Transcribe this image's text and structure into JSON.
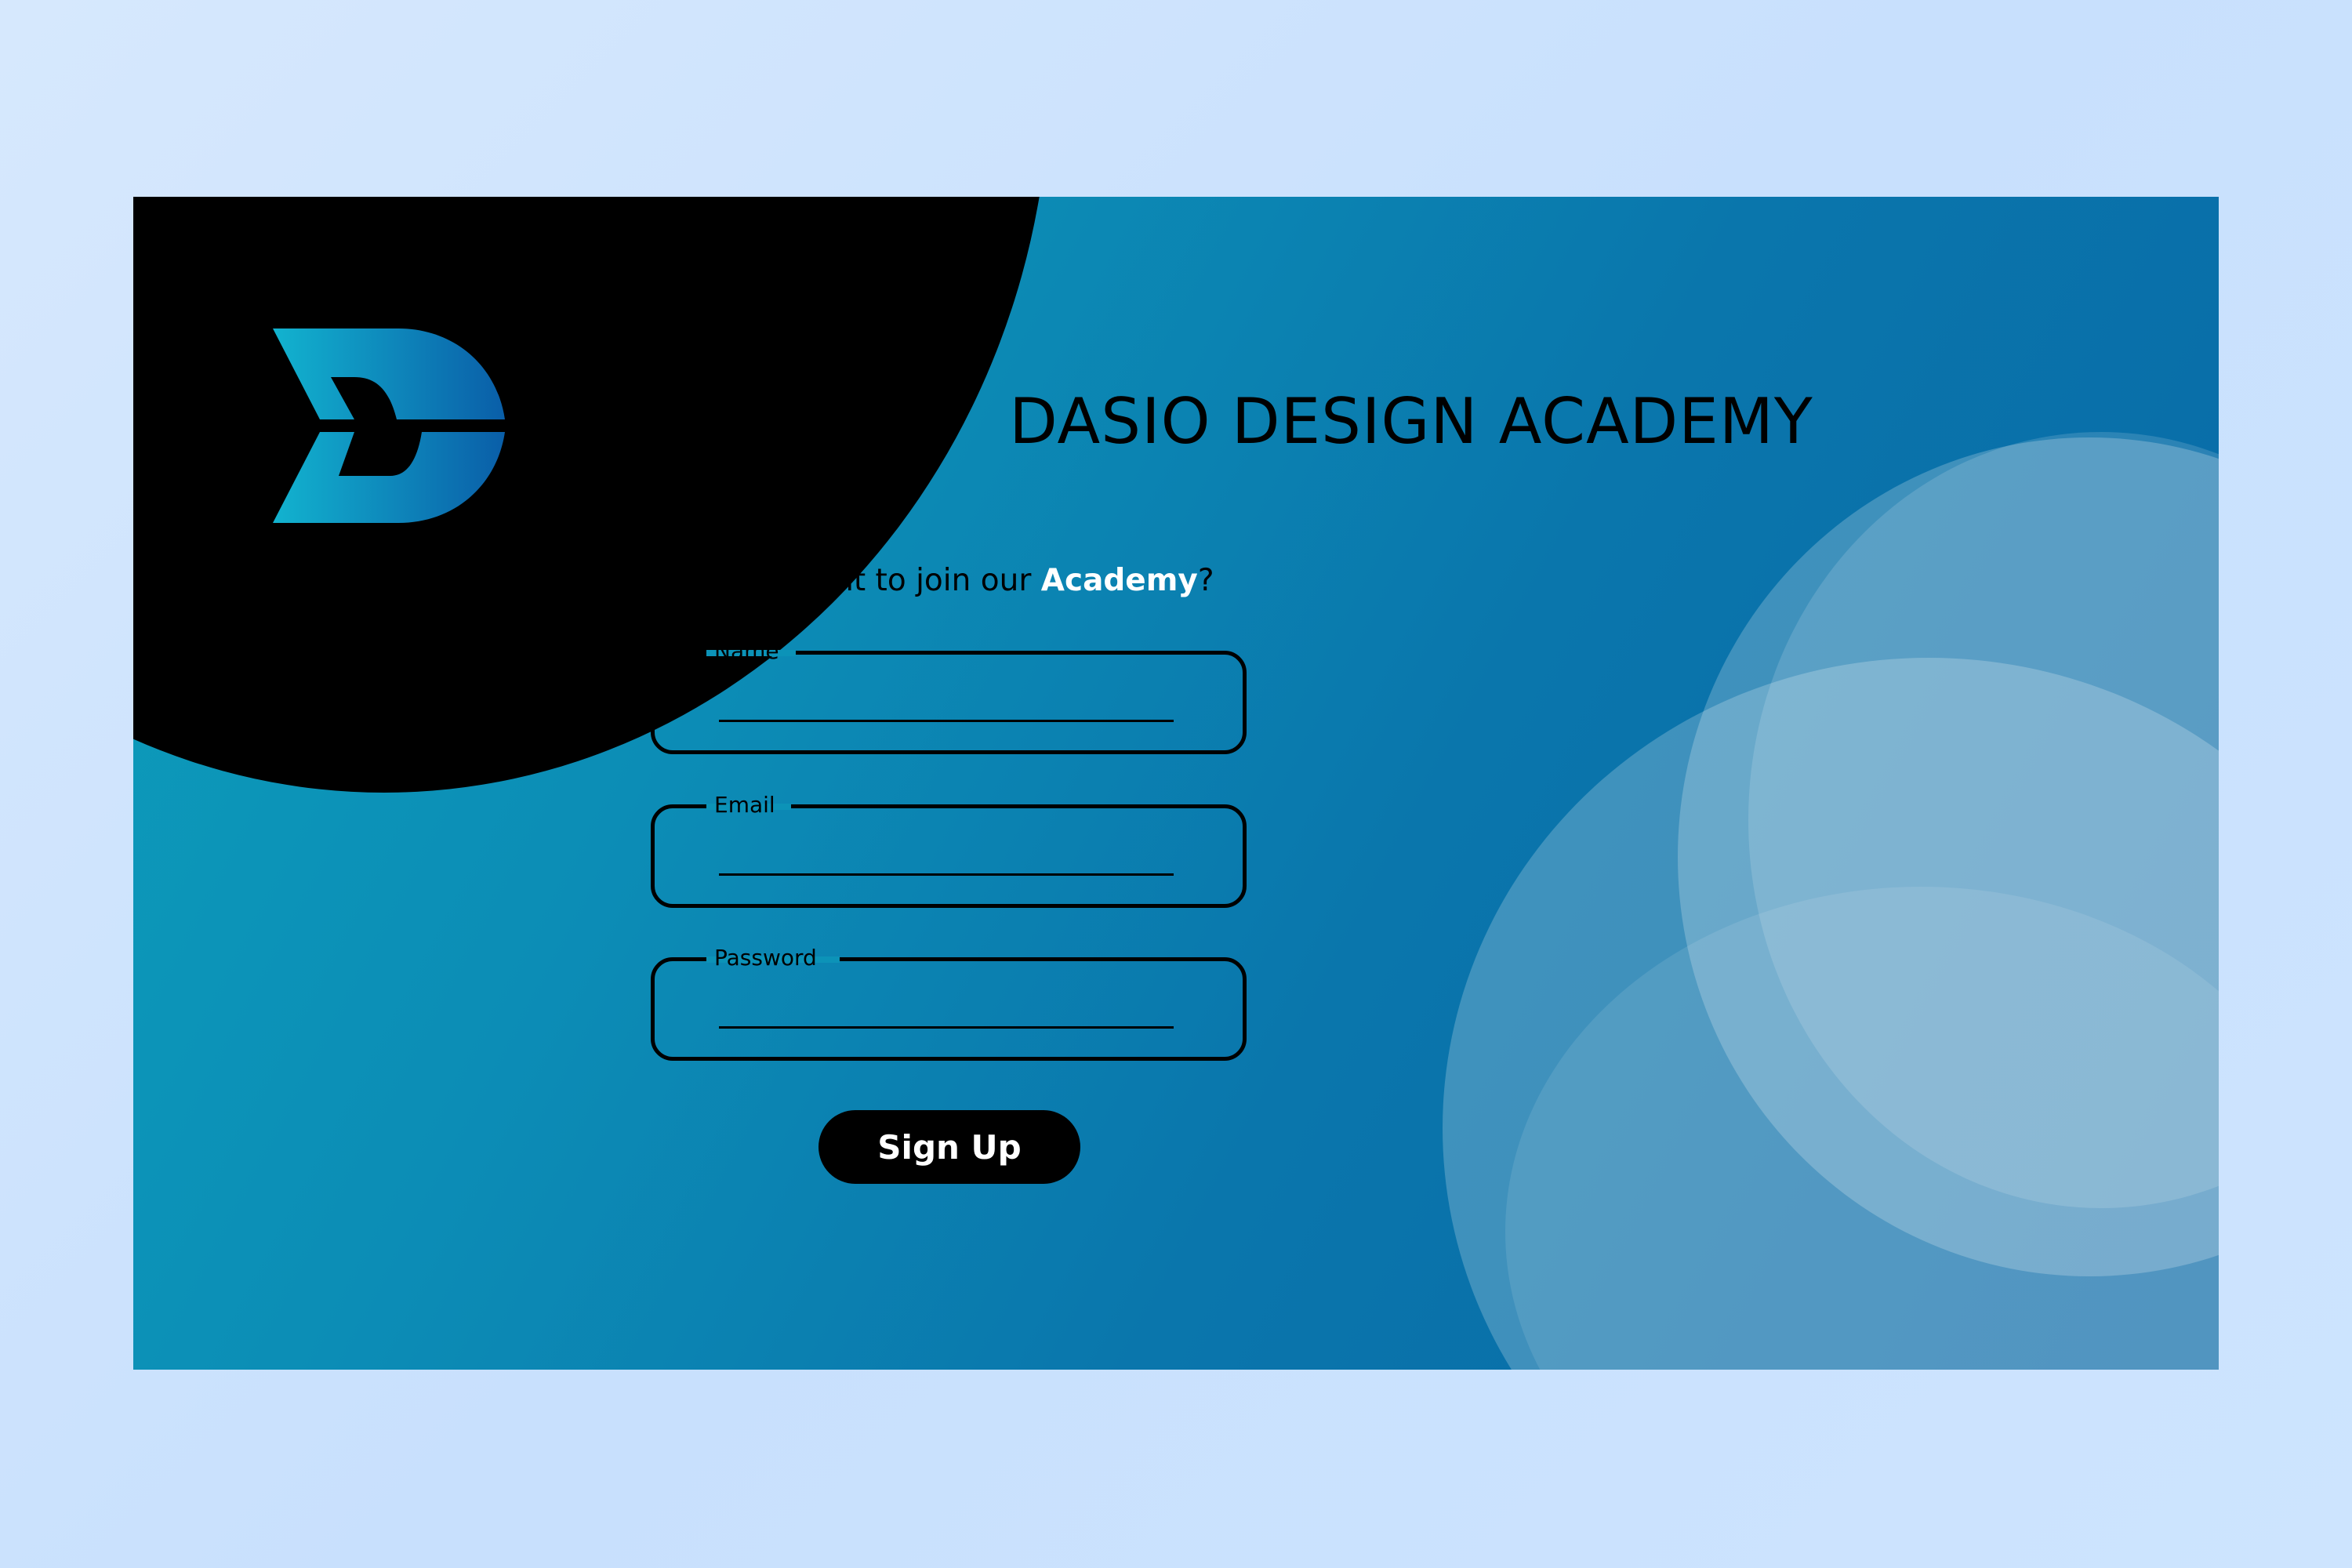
{
  "brand": {
    "logo_icon": "dasio-d-logo",
    "title": "DASIO DESIGN ACADEMY"
  },
  "form": {
    "prompt_prefix": "Do you want to join our ",
    "prompt_accent": "Academy",
    "prompt_suffix": "?",
    "fields": {
      "name": {
        "label": "Name",
        "value": ""
      },
      "email": {
        "label": "Email",
        "value": ""
      },
      "password": {
        "label": "Password",
        "value": ""
      }
    },
    "submit_label": "Sign Up"
  },
  "colors": {
    "page_background": "#d0e5fe",
    "card_gradient_start": "#0d9ebb",
    "card_gradient_end": "#0868a6",
    "accent_text": "#ffffff",
    "button_background": "#000000",
    "logo_gradient_start": "#12b3cf",
    "logo_gradient_end": "#0a5ea8"
  }
}
